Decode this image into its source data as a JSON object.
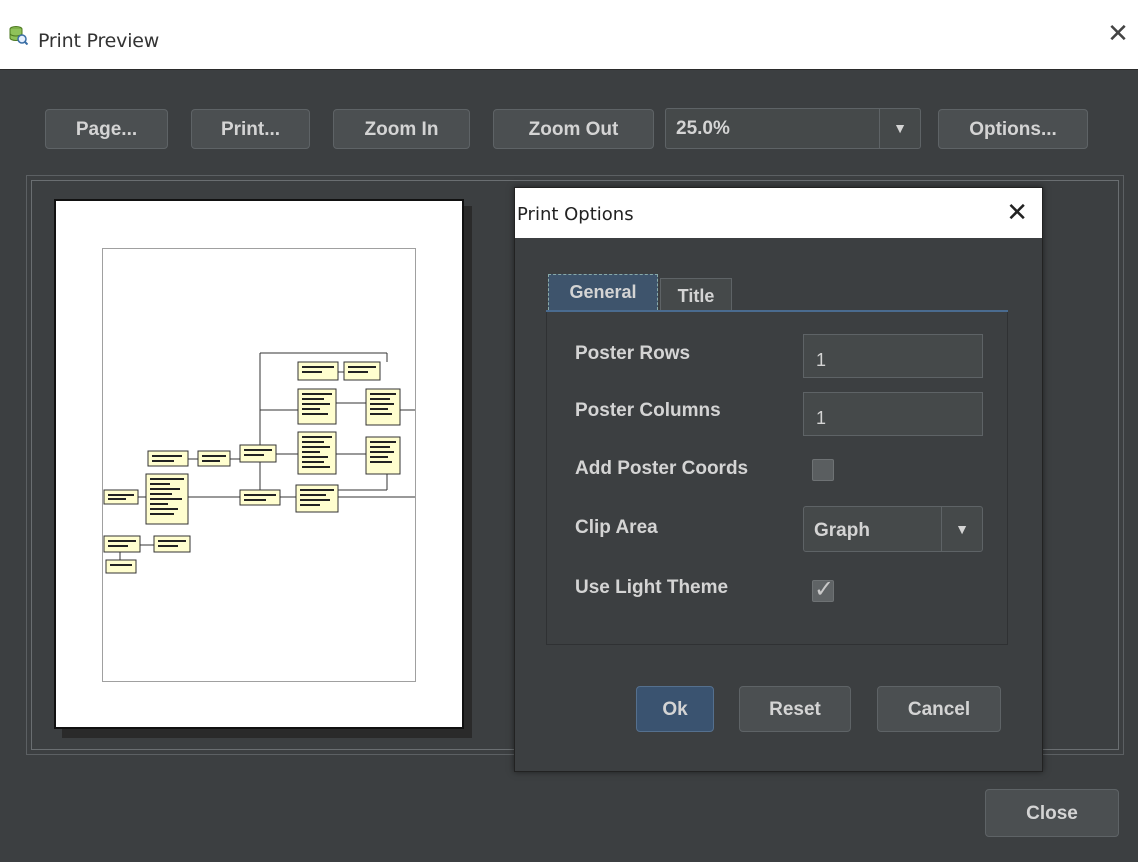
{
  "window": {
    "title": "Print Preview",
    "close_glyph": "✕"
  },
  "toolbar": {
    "page_label": "Page...",
    "print_label": "Print...",
    "zoom_in_label": "Zoom In",
    "zoom_out_label": "Zoom Out",
    "zoom_value": "25.0%",
    "options_label": "Options..."
  },
  "dropdown_glyph": "▼",
  "dialog": {
    "title": "Print Options",
    "close_glyph": "✕",
    "tabs": [
      {
        "label": "General",
        "active": true
      },
      {
        "label": "Title",
        "active": false
      }
    ],
    "fields": {
      "poster_rows_label": "Poster Rows",
      "poster_rows_value": "1",
      "poster_columns_label": "Poster Columns",
      "poster_columns_value": "1",
      "add_poster_coords_label": "Add Poster Coords",
      "add_poster_coords_checked": false,
      "clip_area_label": "Clip Area",
      "clip_area_value": "Graph",
      "use_light_theme_label": "Use Light Theme",
      "use_light_theme_checked": true,
      "check_glyph": "✓"
    },
    "buttons": {
      "ok_label": "Ok",
      "reset_label": "Reset",
      "cancel_label": "Cancel"
    }
  },
  "footer": {
    "close_label": "Close"
  },
  "colors": {
    "background": "#3c3f41",
    "button_bg": "#4b4f51",
    "active_tab": "#3e546c",
    "ok_button": "#3a5370",
    "diagram_node": "#fffecf"
  }
}
